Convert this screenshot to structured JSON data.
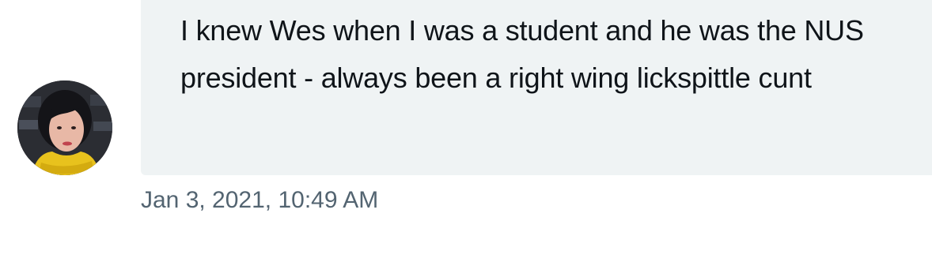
{
  "message": {
    "text": "I knew Wes when I was a student and he was the NUS president - always been a right wing lickspittle cunt",
    "timestamp": "Jan 3, 2021, 10:49 AM"
  },
  "sender": {
    "avatar_icon": "user-avatar-photo"
  },
  "colors": {
    "bubble_background": "#eff3f4",
    "message_text": "#0f1419",
    "timestamp_text": "#536471"
  }
}
